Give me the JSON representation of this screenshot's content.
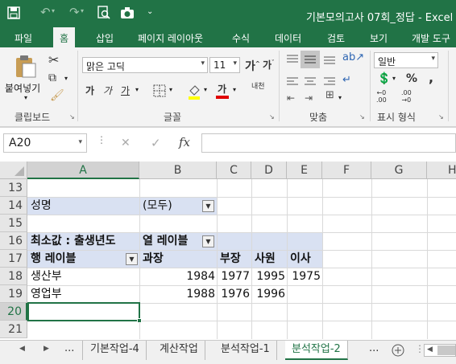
{
  "titlebar": {
    "title": "기본모의고사 07회_정답 - Excel",
    "customize_label": "⌄"
  },
  "ribbon_tabs": [
    "파일",
    "홈",
    "삽입",
    "페이지 레이아웃",
    "수식",
    "데이터",
    "검토",
    "보기",
    "개발 도구"
  ],
  "ribbon": {
    "paste_label": "붙여넣기",
    "clipboard_label": "클립보드",
    "font_name": "맑은 고딕",
    "font_size": "11",
    "font_label": "글꼴",
    "align_label": "맞춤",
    "number_format": "일반",
    "number_label": "표시 형식",
    "bold": "가",
    "italic": "가",
    "underline": "가",
    "font_color_glyph": "가",
    "phonetic": "내천",
    "percent": "%",
    "comma": ","
  },
  "formula_bar": {
    "cell_ref": "A20",
    "fx": "fx",
    "cancel": "✕",
    "enter": "✓",
    "value": ""
  },
  "columns": [
    "A",
    "B",
    "C",
    "D",
    "E",
    "F",
    "G",
    "H"
  ],
  "rows": [
    "13",
    "14",
    "15",
    "16",
    "17",
    "18",
    "19",
    "20",
    "21"
  ],
  "pivot": {
    "filter_field": "성명",
    "filter_value": "(모두)",
    "value_label": "최소값 : 출생년도",
    "col_labels": "열 레이블",
    "row_labels": "행 레이블",
    "col_items": [
      "과장",
      "부장",
      "사원",
      "이사"
    ],
    "rows": [
      {
        "label": "생산부",
        "values": [
          "1984",
          "1977",
          "1995",
          "1975"
        ]
      },
      {
        "label": "영업부",
        "values": [
          "1988",
          "1976",
          "1996",
          ""
        ]
      }
    ]
  },
  "sheet_tabs": [
    "...",
    "기본작업-4",
    "계산작업",
    "분석작업-1",
    "분석작업-2",
    "..."
  ],
  "active_sheet": "분석작업-2"
}
